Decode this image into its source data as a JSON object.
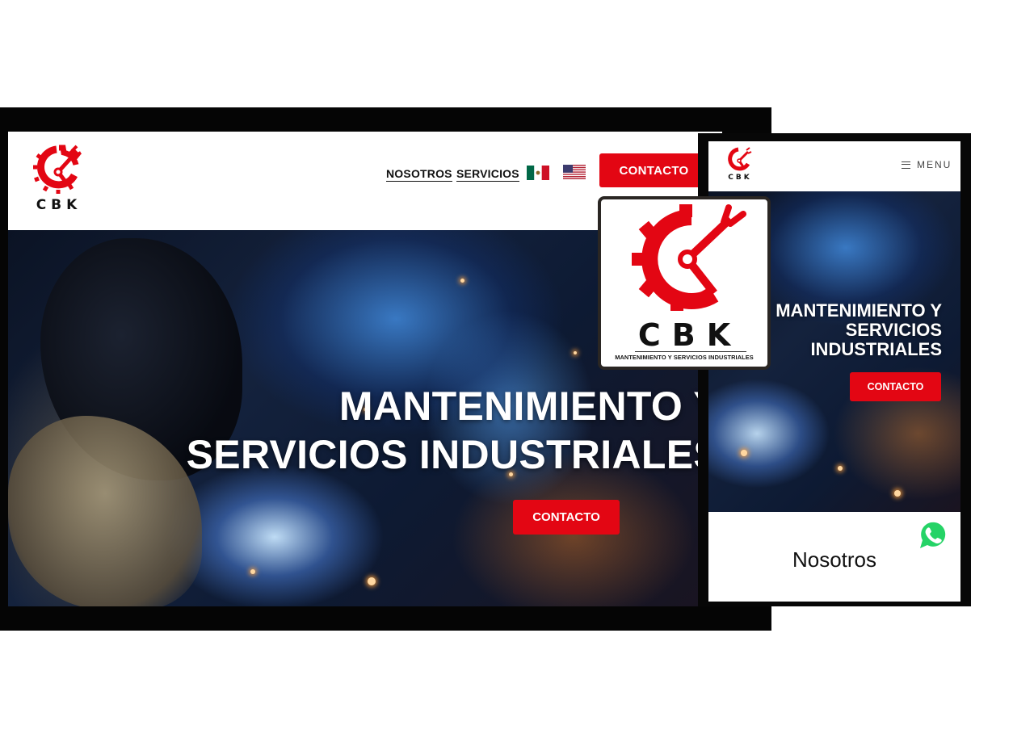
{
  "desktop": {
    "logo_text": "CBK",
    "nav": {
      "nosotros": "NOSOTROS",
      "servicios": "SERVICIOS",
      "contacto": "CONTACTO"
    },
    "flags": [
      "mexico-flag-icon",
      "usa-flag-icon"
    ],
    "hero": {
      "title_line1": "MANTENIMIENTO Y",
      "title_line2": "SERVICIOS INDUSTRIALES",
      "button": "CONTACTO"
    }
  },
  "mobile": {
    "logo_text": "CBK",
    "menu_label": "MENU",
    "hero": {
      "title_line1": "MANTENIMIENTO Y",
      "title_line2": "SERVICIOS",
      "title_line3": "INDUSTRIALES",
      "button": "CONTACTO"
    },
    "section_title": "Nosotros"
  },
  "logo_card": {
    "brand": "CBK",
    "tagline": "MANTENIMIENTO Y SERVICIOS INDUSTRIALES"
  },
  "colors": {
    "brand_red": "#e30613",
    "frame": "#050505",
    "whatsapp": "#25d366"
  }
}
